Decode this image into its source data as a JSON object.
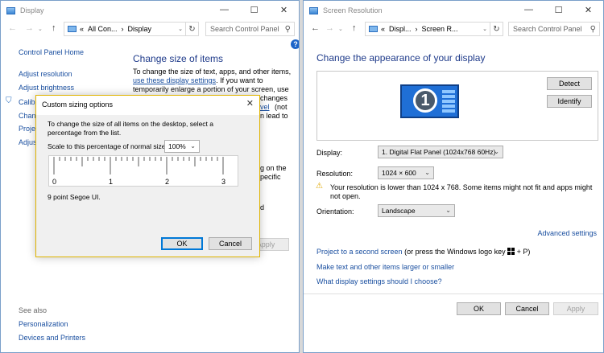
{
  "left_window": {
    "title": "Display",
    "window_controls": {
      "minimize": "—",
      "maximize": "☐",
      "close": "✕"
    },
    "address": {
      "prefix": "«",
      "crumb1": "All Con...",
      "sep": "›",
      "crumb2": "Display"
    },
    "search_placeholder": "Search Control Panel",
    "sidebar": {
      "home": "Control Panel Home",
      "items": [
        "Adjust resolution",
        "Adjust brightness",
        "Calibr",
        "Chang",
        "Projec",
        "Adjus"
      ],
      "see_also_label": "See also",
      "see_also_items": [
        "Personalization",
        "Devices and Printers"
      ]
    },
    "main": {
      "title": "Change size of items",
      "line1": "To change the size of text, apps, and other items,",
      "link": "use these display settings",
      "line2_rest": ".  If you want to",
      "line3": "temporarily enlarge a portion of your screen, use",
      "fragments": [
        "changes",
        "(not",
        "n lead to",
        "g on the",
        "pecific",
        "d"
      ],
      "link_fragment": "vel",
      "apply_label": "Apply"
    }
  },
  "dialog": {
    "title": "Custom sizing options",
    "close_glyph": "✕",
    "instruction": "To change the size of all items on the desktop, select a percentage from the list.",
    "scale_label": "Scale to this percentage of normal size:",
    "scale_value": "100%",
    "ruler_labels": [
      "0",
      "1",
      "2",
      "3"
    ],
    "font_sample": "9 point Segoe UI.",
    "ok_label": "OK",
    "cancel_label": "Cancel"
  },
  "right_window": {
    "title": "Screen Resolution",
    "window_controls": {
      "minimize": "—",
      "maximize": "☐",
      "close": "✕"
    },
    "address": {
      "prefix": "«",
      "crumb1": "Displ...",
      "sep": "›",
      "crumb2": "Screen R..."
    },
    "search_placeholder": "Search Control Panel",
    "heading": "Change the appearance of your display",
    "monitor_number": "1",
    "detect_label": "Detect",
    "identify_label": "Identify",
    "display_label": "Display:",
    "display_value": "1. Digital Flat Panel (1024x768 60Hz)",
    "resolution_label": "Resolution:",
    "resolution_value": "1024 × 600",
    "warning": "Your resolution is lower than 1024 x 768. Some items might not fit and apps might not open.",
    "orientation_label": "Orientation:",
    "orientation_value": "Landscape",
    "advanced_link": "Advanced settings",
    "project_link": "Project to a second screen",
    "project_rest_before": "(or press the Windows logo key",
    "project_rest_after": "+ P)",
    "link2": "Make text and other items larger or smaller",
    "link3": "What display settings should I choose?",
    "ok_label": "OK",
    "cancel_label": "Cancel",
    "apply_label": "Apply"
  }
}
